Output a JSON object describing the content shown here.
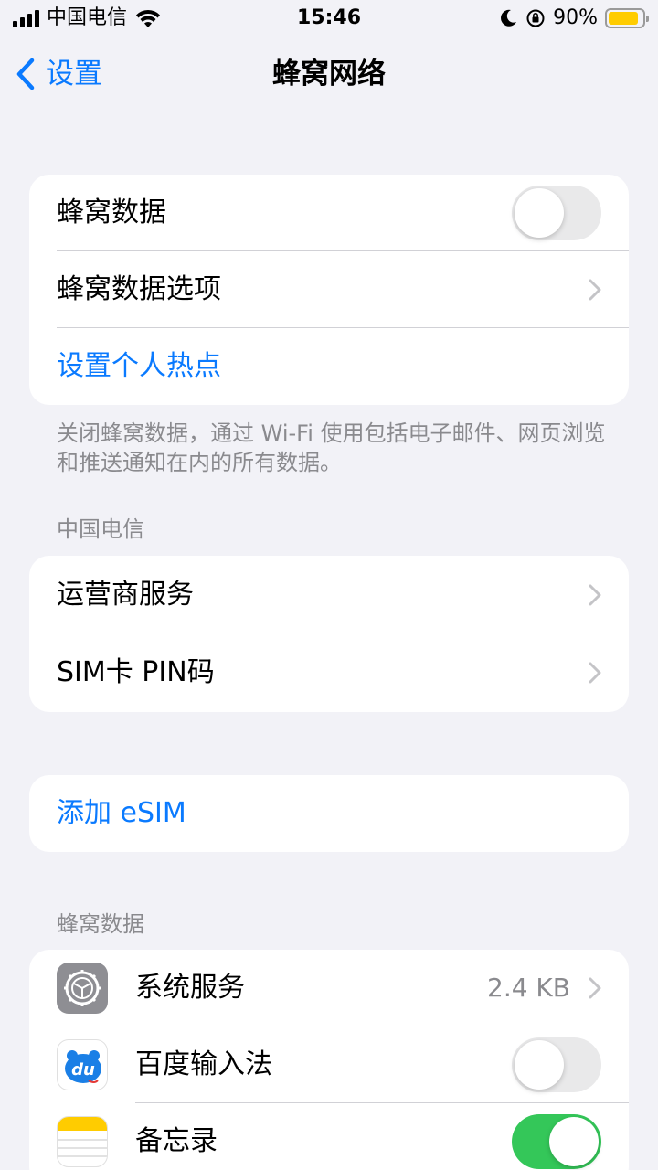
{
  "status_bar": {
    "carrier": "中国电信",
    "time": "15:46",
    "battery_percent": "90%",
    "battery_level": 0.9,
    "battery_color": "#ffcc00"
  },
  "nav": {
    "back_label": "设置",
    "title": "蜂窝网络",
    "accent": "#0a7aff"
  },
  "group1": {
    "cellular_data": {
      "label": "蜂窝数据",
      "toggle_on": false
    },
    "cellular_options": {
      "label": "蜂窝数据选项"
    },
    "hotspot": {
      "label": "设置个人热点"
    }
  },
  "group1_footer": "关闭蜂窝数据，通过 Wi‑Fi 使用包括电子邮件、网页浏览和推送通知在内的所有数据。",
  "carrier_section": {
    "header": "中国电信",
    "rows": [
      {
        "label": "运营商服务"
      },
      {
        "label": "SIM卡 PIN码"
      }
    ]
  },
  "esim": {
    "label": "添加 eSIM"
  },
  "cellular_data_section": {
    "header": "蜂窝数据",
    "apps": [
      {
        "label": "系统服务",
        "icon": "gear-icon",
        "value": "2.4 KB"
      },
      {
        "label": "百度输入法",
        "icon": "baidu-input-icon",
        "icon_text": "du",
        "toggle_on": false
      },
      {
        "label": "备忘录",
        "icon": "notes-icon",
        "toggle_on": true
      }
    ]
  }
}
